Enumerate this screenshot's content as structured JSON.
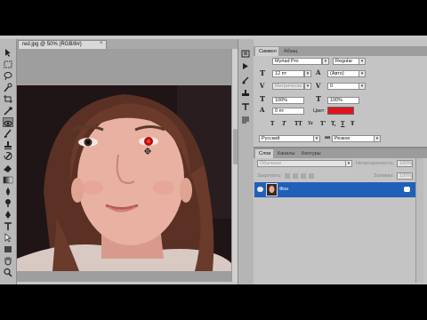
{
  "document": {
    "tab_title": "red.jpg @ 50% (RGB/8#)",
    "close_glyph": "×"
  },
  "character_panel": {
    "tabs": [
      "Символ",
      "Абзац"
    ],
    "font_family": "Myriad Pro",
    "font_style": "Regular",
    "font_size": "12 пт",
    "leading": "(Авто)",
    "kerning": "Метрически",
    "tracking": "0",
    "vertical_scale": "100%",
    "horizontal_scale": "100%",
    "baseline_shift": "0 пт",
    "color_label": "Цвет:",
    "color": "#e0141e",
    "style_buttons": [
      "T",
      "T",
      "TT",
      "Tr",
      "T'",
      "T,",
      "T",
      "Ŧ"
    ],
    "language": "Русский",
    "antialias_icon": "aa",
    "antialias": "Резкое"
  },
  "layers_panel": {
    "tabs": [
      "Слои",
      "Каналы",
      "Контуры"
    ],
    "blend_mode": "Обычные",
    "opacity_label": "Непрозрачность:",
    "opacity": "100%",
    "lock_label": "Закрепить:",
    "fill_label": "Заливка:",
    "fill": "100%",
    "layer_name": "Фон"
  },
  "colors": {
    "panel_bg": "#c4c4c4",
    "selected_layer": "#2060b8",
    "app_frame": "#c8c8c8"
  }
}
